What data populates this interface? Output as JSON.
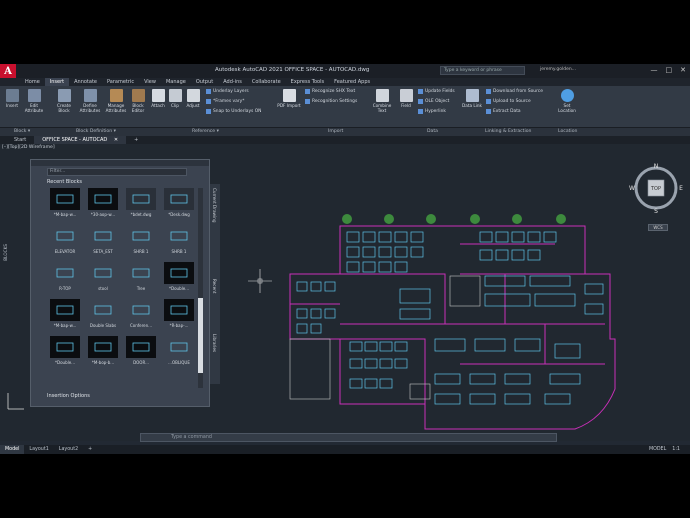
{
  "titlebar": {
    "logo": "A",
    "title": "Autodesk AutoCAD 2021   OFFICE SPACE - AUTOCAD.dwg",
    "search_placeholder": "Type a keyword or phrase",
    "user": "jeremy.golden...",
    "minimize": "—",
    "maximize": "□",
    "close": "✕"
  },
  "ribbon_tabs": [
    "Home",
    "Insert",
    "Annotate",
    "Parametric",
    "View",
    "Manage",
    "Output",
    "Add-ins",
    "Collaborate",
    "Express Tools",
    "Featured Apps"
  ],
  "active_ribbon_tab": "Insert",
  "ribbon": {
    "insert": "Insert",
    "edit_attribute": "Edit Attribute",
    "create_block": "Create Block",
    "define_attributes": "Define Attributes",
    "manage_attributes": "Manage Attributes",
    "block_editor": "Block Editor",
    "attach": "Attach",
    "clip": "Clip",
    "adjust": "Adjust",
    "underlay_layers": "Underlay Layers",
    "frames_vary": "*Frames vary*",
    "snap_to_underlays": "Snap to Underlays ON",
    "pdf_import": "PDF Import",
    "recognize_shx": "Recognize SHX Text",
    "recognition_settings": "Recognition Settings",
    "combine_text": "Combine Text",
    "field": "Field",
    "update_fields": "Update Fields",
    "ole_object": "OLE Object",
    "hyperlink": "Hyperlink",
    "data_link": "Data Link",
    "download_from_source": "Download from Source",
    "upload_to_source": "Upload to Source",
    "extract_data": "Extract  Data",
    "set_location": "Set Location"
  },
  "ribbon_panels": {
    "block": "Block ▾",
    "block_definition": "Block Definition ▾",
    "reference": "Reference ▾",
    "import": "Import",
    "data": "Data",
    "linking_extraction": "Linking & Extraction",
    "location": "Location"
  },
  "doc_tabs": [
    "Start",
    "OFFICE SPACE - AUTOCAD"
  ],
  "doc_tab_close": "✕",
  "doc_tab_add": "+",
  "viewport_label": "[–][Top][2D Wireframe]",
  "palette": {
    "filter_placeholder": "Filter...",
    "section_title": "Recent Blocks",
    "blocks": [
      {
        "label": "*M-bap-w...",
        "style": "dark"
      },
      {
        "label": "*30-aop-w...",
        "style": "dark"
      },
      {
        "label": "*bdet.dwg",
        "style": "normal"
      },
      {
        "label": "*Desk.dwg",
        "style": "normal"
      },
      {
        "label": "ELEVATOR",
        "style": "lt"
      },
      {
        "label": "SETA_EST",
        "style": "lt"
      },
      {
        "label": "SHRB 1",
        "style": "lt"
      },
      {
        "label": "SHRB 1",
        "style": "lt"
      },
      {
        "label": "R-TOP",
        "style": "lt"
      },
      {
        "label": "stool",
        "style": "lt"
      },
      {
        "label": "Tree",
        "style": "lt"
      },
      {
        "label": "*Double...",
        "style": "dark"
      },
      {
        "label": "*M-bap-w...",
        "style": "dark"
      },
      {
        "label": "Double Slabs",
        "style": "lt"
      },
      {
        "label": "Conferen...",
        "style": "lt"
      },
      {
        "label": "*R-bap-...",
        "style": "dark"
      },
      {
        "label": "*Double...",
        "style": "dark"
      },
      {
        "label": "*M-bop-b...",
        "style": "dark"
      },
      {
        "label": "DOOR...",
        "style": "dark"
      },
      {
        "label": "...OBLIQUE",
        "style": "lt"
      }
    ],
    "insertion_options": "Insertion Options",
    "side_tabs": [
      "Current Drawing",
      "Recent",
      "Libraries"
    ],
    "palette_title": "BLOCKS"
  },
  "viewcube": {
    "n": "N",
    "s": "S",
    "e": "E",
    "w": "W",
    "top": "TOP",
    "wcs": "WCS"
  },
  "command_line": {
    "placeholder": "Type a command"
  },
  "status_tabs": [
    "Model",
    "Layout1",
    "Layout2"
  ],
  "status_add": "+",
  "status_model": "MODEL",
  "status_scale": "1:1",
  "colors": {
    "accent_red": "#c8102e",
    "walls": "#c92fb8",
    "furniture": "#5fc4e8",
    "plants": "#3d8a3d"
  }
}
